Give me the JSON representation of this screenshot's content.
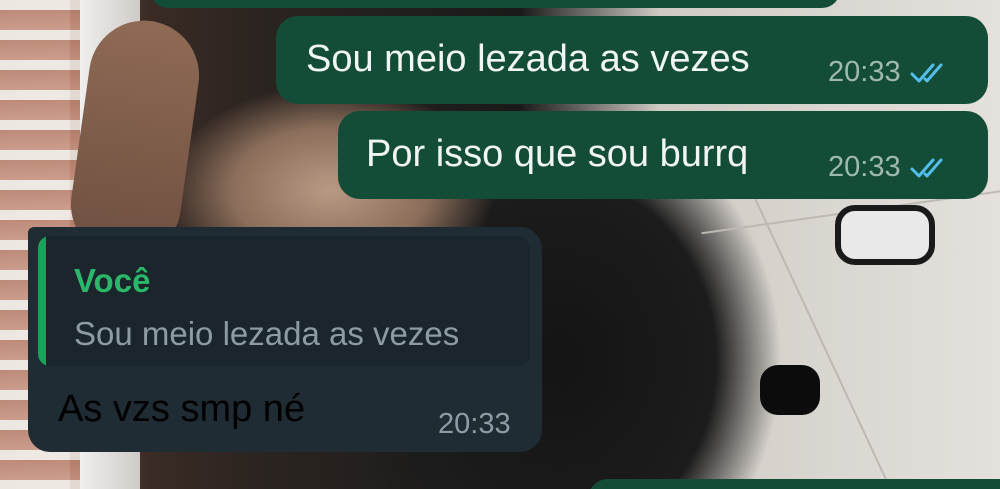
{
  "conversation": {
    "messages": [
      {
        "direction": "outgoing",
        "text": "Sou meio lezada as vezes",
        "time": "20:33",
        "status": "read"
      },
      {
        "direction": "outgoing",
        "text": "Por isso que sou burrq",
        "time": "20:33",
        "status": "read"
      },
      {
        "direction": "incoming",
        "reply_to": {
          "author": "Você",
          "text": "Sou meio lezada as vezes"
        },
        "text": "As vzs smp né",
        "time": "20:33"
      }
    ]
  },
  "colors": {
    "outgoing_bubble": "#144d37",
    "incoming_bubble": "#1f2c33",
    "quote_accent": "#1da15a",
    "read_ticks": "#53bdeb"
  },
  "icons": {
    "read_receipt": "double-check-icon"
  }
}
